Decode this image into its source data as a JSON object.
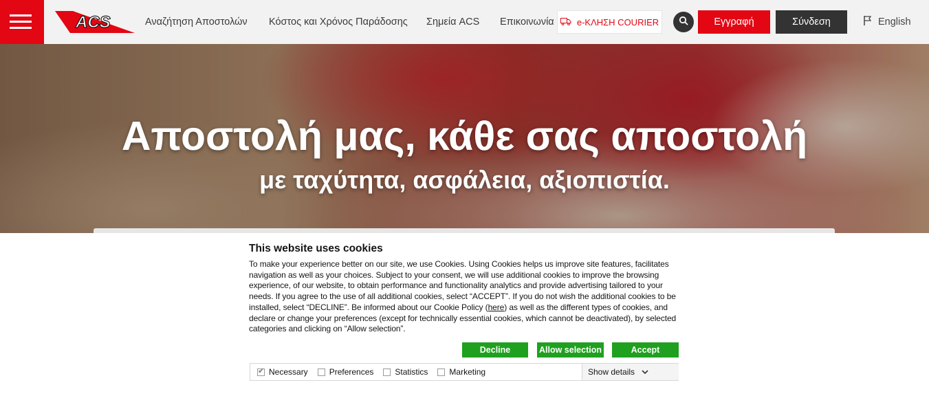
{
  "header": {
    "logo_text": "ACS",
    "nav": [
      {
        "label": "Αναζήτηση Αποστολών"
      },
      {
        "label": "Κόστος και Χρόνος Παράδοσης"
      },
      {
        "label": "Σημεία ACS"
      },
      {
        "label": "Επικοινωνία"
      }
    ],
    "courier_label": "e-ΚΛΗΣΗ COURIER",
    "register_label": "Εγγραφή",
    "login_label": "Σύνδεση",
    "language_label": "English",
    "colors": {
      "brand_red": "#e30613",
      "dark": "#333333"
    }
  },
  "hero": {
    "title": "Αποστολή μας, κάθε σας αποστολή",
    "subtitle": "με ταχύτητα, ασφάλεια, αξιοπιστία."
  },
  "cookie_banner": {
    "title": "This website uses cookies",
    "text_before_link": "To make your experience better on our site, we use Cookies. Using Cookies helps us improve site features, facilitates navigation as well as your choices. Subject to your consent, we will use additional cookies to improve the browsing experience, of our website, to obtain performance and functionality analytics and provide advertising tailored to your needs. If you agree to the use of all additional cookies, select “ACCEPT”. If you do not wish the additional cookies to be installed, select “DECLINE”. Be informed about our Cookie Policy (",
    "link_text": "here",
    "text_after_link": ") as well as the different types of cookies, and declare or change your preferences (except for technically essential cookies, which cannot be deactivated), by selected categories and clicking on “Allow selection”.",
    "buttons": {
      "decline": "Decline",
      "allow_selection": "Allow selection",
      "accept": "Accept"
    },
    "options": [
      {
        "label": "Necessary",
        "checked": true
      },
      {
        "label": "Preferences",
        "checked": false
      },
      {
        "label": "Statistics",
        "checked": false
      },
      {
        "label": "Marketing",
        "checked": false
      }
    ],
    "show_details_label": "Show details",
    "button_color": "#1fa01f"
  }
}
